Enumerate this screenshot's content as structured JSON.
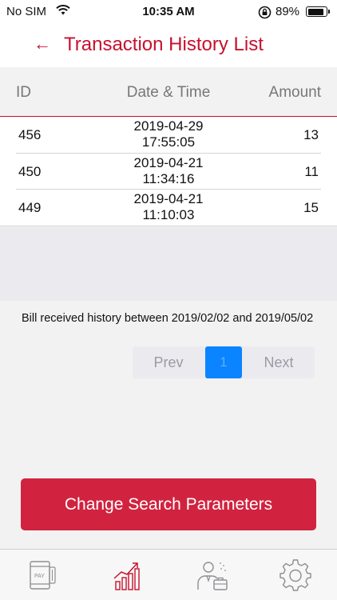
{
  "status_bar": {
    "carrier": "No SIM",
    "time": "10:35 AM",
    "battery": "89%",
    "battery_level": 0.89,
    "icons": [
      "wifi-icon",
      "orientation-lock-icon",
      "battery-icon"
    ]
  },
  "header": {
    "back_icon": "arrow-left-icon",
    "back_glyph": "←",
    "title": "Transaction History List",
    "accent_color": "#c8102e"
  },
  "table": {
    "columns": [
      "ID",
      "Date & Time",
      "Amount"
    ],
    "rows": [
      {
        "id": "456",
        "date": "2019-04-29",
        "time": "17:55:05",
        "amount": "13"
      },
      {
        "id": "450",
        "date": "2019-04-21",
        "time": "11:34:16",
        "amount": "11"
      },
      {
        "id": "449",
        "date": "2019-04-21",
        "time": "11:10:03",
        "amount": "15"
      }
    ]
  },
  "info": {
    "history_text": "Bill received history between 2019/02/02 and 2019/05/02"
  },
  "pagination": {
    "prev": "Prev",
    "current": "1",
    "next": "Next",
    "active_color": "#0a84ff"
  },
  "action": {
    "change_search_label": "Change Search Parameters",
    "button_color": "#d1233f"
  },
  "tabbar": {
    "tabs": [
      {
        "icon": "pay-phone-icon",
        "label": "PAY",
        "active": false
      },
      {
        "icon": "growth-chart-icon",
        "active": true
      },
      {
        "icon": "business-person-icon",
        "active": false
      },
      {
        "icon": "gear-icon",
        "active": false
      }
    ],
    "active_color": "#c8102e",
    "inactive_color": "#8e8e93"
  }
}
